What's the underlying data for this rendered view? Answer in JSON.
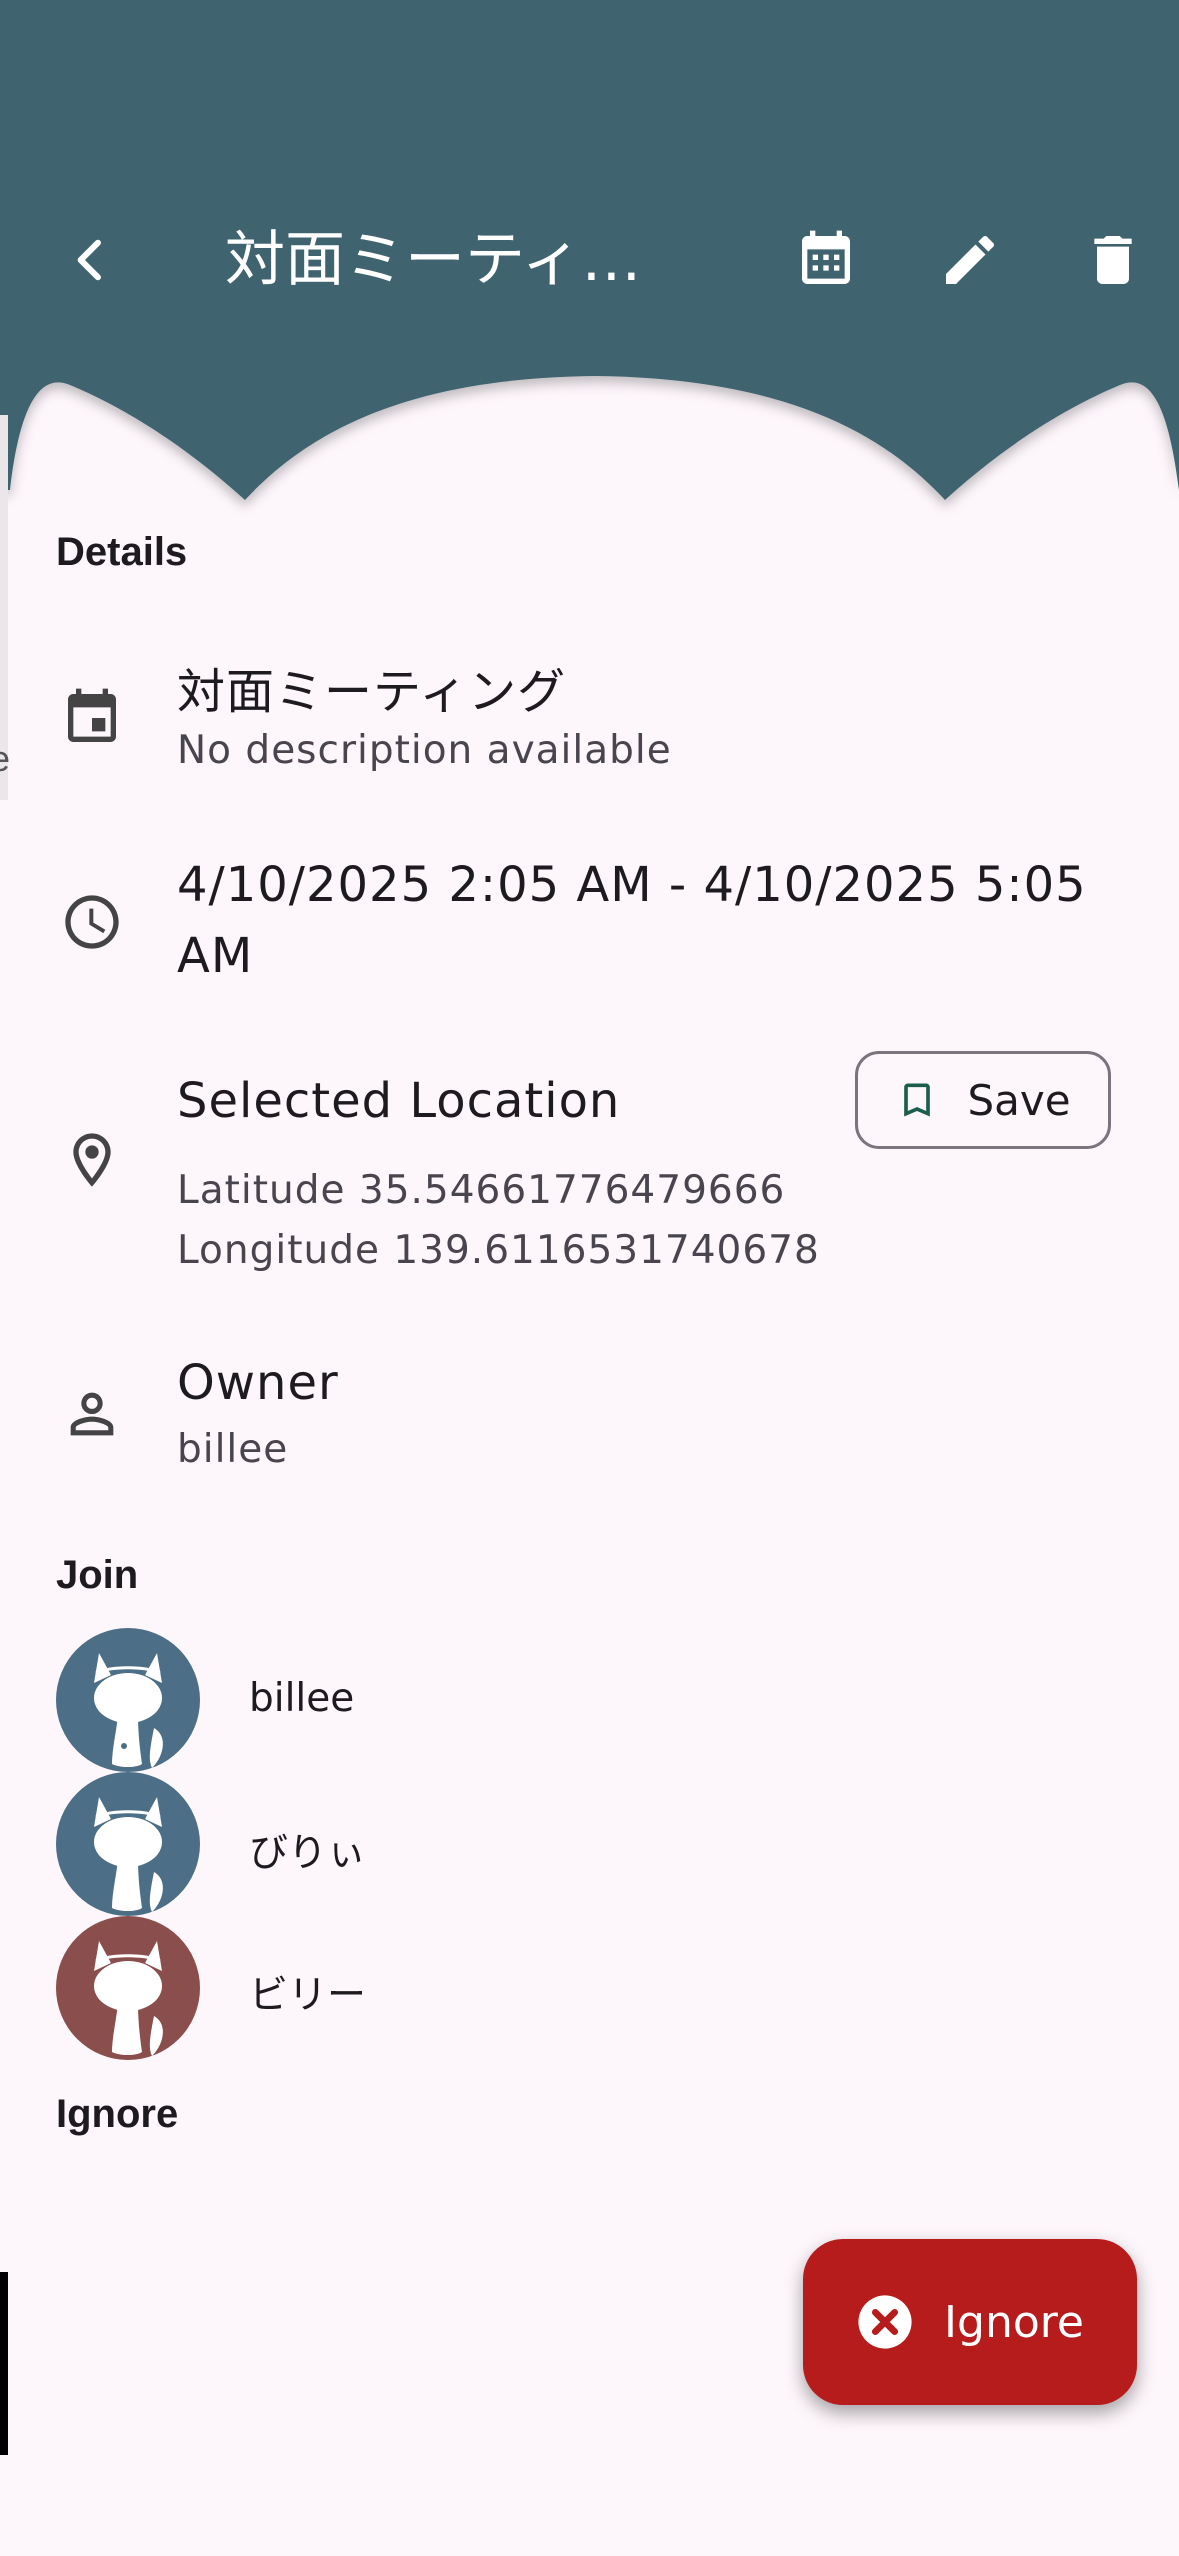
{
  "colors": {
    "header": "#3f6470",
    "background": "#fdf6fb",
    "fab": "#b71c1c",
    "avatar_blue": "#4c6f87",
    "avatar_red": "#8a4e4c"
  },
  "appbar": {
    "title": "対面ミーティ…",
    "icons": [
      "back-arrow-icon",
      "calendar-icon",
      "edit-pencil-icon",
      "delete-trash-icon"
    ]
  },
  "details": {
    "heading": "Details",
    "event_title": "対面ミーティング",
    "event_description": "No description available",
    "time_range": "4/10/2025 2:05 AM - 4/10/2025 5:05",
    "time_range_wrap": "AM",
    "location_title": "Selected Location",
    "latitude": "Latitude 35.54661776479666",
    "longitude": "Longitude 139.6116531740678",
    "save_label": "Save",
    "owner_label": "Owner",
    "owner_name": "billee"
  },
  "join": {
    "heading": "Join",
    "members": [
      {
        "name": "billee",
        "avatar_color": "#4c6f87"
      },
      {
        "name": "びりぃ",
        "avatar_color": "#4c6f87"
      },
      {
        "name": "ビリー",
        "avatar_color": "#8a4e4c"
      }
    ]
  },
  "ignore": {
    "heading": "Ignore",
    "fab_label": "Ignore"
  },
  "edge": {
    "clipped_text": "e"
  }
}
